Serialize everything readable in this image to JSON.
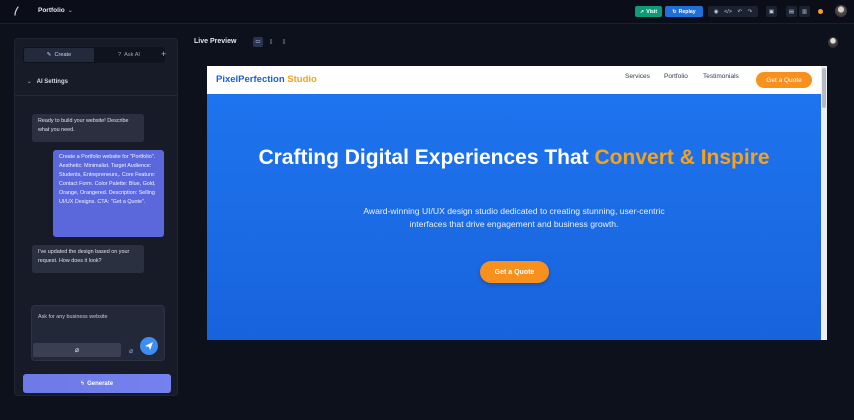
{
  "topbar": {
    "project_name": "Portfolio",
    "visit_label": "Visit",
    "replay_label": "Replay",
    "colors": {
      "visit": "#0f9a78",
      "replay": "#1f6fd8",
      "status_dot": "#f4a020"
    }
  },
  "sidebar": {
    "tabs": [
      {
        "label": "Create",
        "icon": "pencil-icon"
      },
      {
        "label": "Ask AI",
        "icon": "question-icon"
      }
    ],
    "section_title": "AI Settings",
    "messages": [
      {
        "role": "assistant",
        "text": "Ready to build your website! Describe what you need."
      },
      {
        "role": "user",
        "text": "Create a Portfolio website for \"Portfolio\". Aesthetic: Minimalist. Target Audience: Students, Entrepreneurs,. Core Feature: Contact Form. Color Palette: Blue, Gold, Orange, Orangered. Description: Selling UI/UX Designs. CTA: \"Get a Quote\"."
      },
      {
        "role": "assistant",
        "text": "I've updated the design based on your request. How does it look?"
      }
    ],
    "input_placeholder": "Ask for any business website",
    "generate_label": "Generate"
  },
  "preview": {
    "title": "Live Preview",
    "site": {
      "brand_primary": "PixelPerfection",
      "brand_accent": "Studio",
      "nav_links": [
        "Services",
        "Portfolio",
        "Testimonials"
      ],
      "nav_cta": "Get a Quote",
      "headline_main": "Crafting Digital Experiences That ",
      "headline_highlight": "Convert & Inspire",
      "subheadline": "Award-winning UI/UX design studio dedicated to creating stunning, user-centric interfaces that drive engagement and business growth.",
      "hero_cta": "Get a Quote",
      "colors": {
        "primary": "#1a6ee8",
        "accent": "#f7a21b",
        "cta": "#f7901d"
      }
    }
  }
}
